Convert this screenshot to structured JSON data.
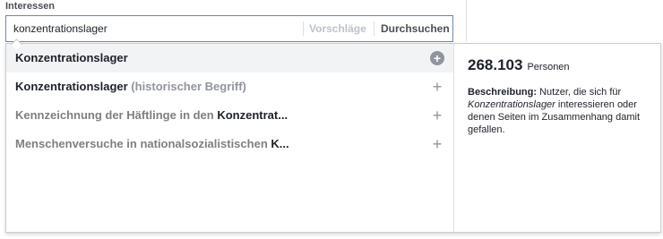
{
  "field_label": "Interessen",
  "search": {
    "value": "konzentrationslager",
    "suggestions_label": "Vorschläge",
    "browse_label": "Durchsuchen"
  },
  "results": [
    {
      "parts": [
        {
          "text": "Konzentrationslager",
          "tone": "dark"
        }
      ]
    },
    {
      "parts": [
        {
          "text": "Konzentrationslager",
          "tone": "dark"
        },
        {
          "text": " (historischer Begriff)",
          "tone": "grey"
        }
      ]
    },
    {
      "parts": [
        {
          "text": "Kennzeichnung der Häftlinge in den ",
          "tone": "mid"
        },
        {
          "text": "Konzentrat...",
          "tone": "dark"
        }
      ]
    },
    {
      "parts": [
        {
          "text": "Menschenversuche in nationalsozialistischen ",
          "tone": "mid"
        },
        {
          "text": "K...",
          "tone": "dark"
        }
      ]
    }
  ],
  "detail": {
    "count": "268.103",
    "count_unit": "Personen",
    "desc_label": "Beschreibung:",
    "desc_pre": "Nutzer, die sich für",
    "desc_em": "Konzentrationslager",
    "desc_post": "interessieren oder denen Seiten im Zusammenhang damit gefallen."
  },
  "icons": {
    "add": "plus-icon",
    "add_active": "plus-circle-icon"
  }
}
